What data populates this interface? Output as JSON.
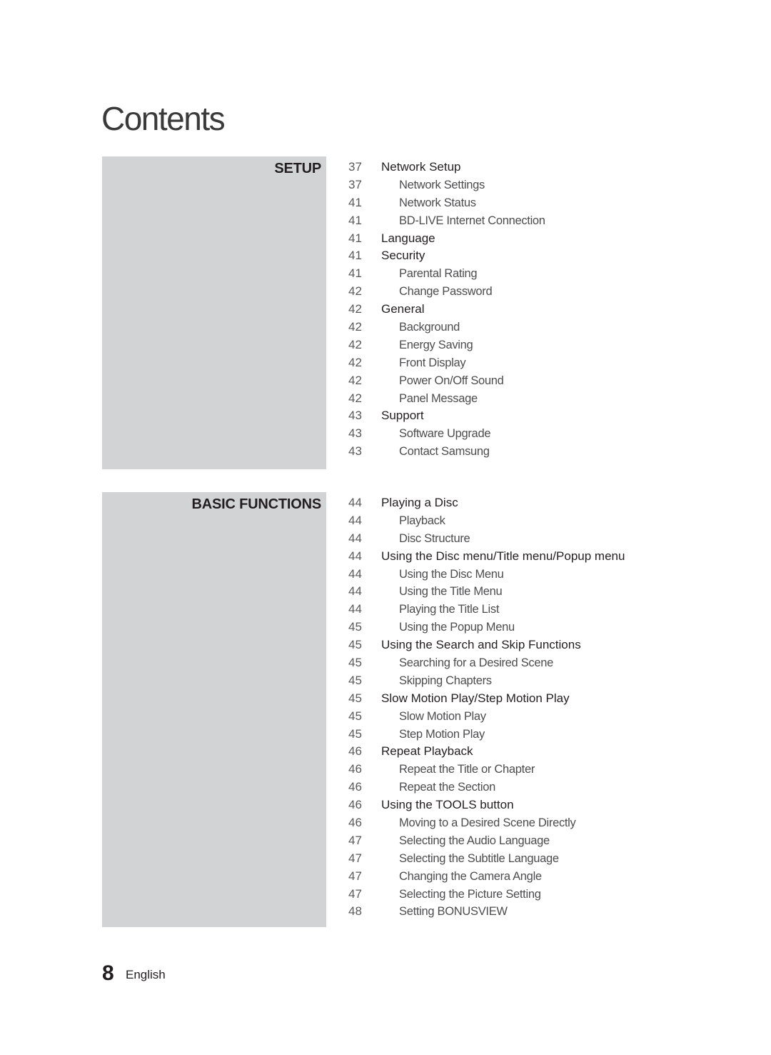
{
  "page": {
    "title": "Contents",
    "footer": {
      "page_number": "8",
      "language": "English"
    }
  },
  "sections": [
    {
      "label": "SETUP",
      "entries": [
        {
          "page": "37",
          "title": "Network Setup",
          "level": "main"
        },
        {
          "page": "37",
          "title": "Network Settings",
          "level": "sub"
        },
        {
          "page": "41",
          "title": "Network Status",
          "level": "sub"
        },
        {
          "page": "41",
          "title": "BD-LIVE Internet Connection",
          "level": "sub"
        },
        {
          "page": "41",
          "title": "Language",
          "level": "main"
        },
        {
          "page": "41",
          "title": "Security",
          "level": "main"
        },
        {
          "page": "41",
          "title": "Parental Rating",
          "level": "sub"
        },
        {
          "page": "42",
          "title": "Change Password",
          "level": "sub"
        },
        {
          "page": "42",
          "title": "General",
          "level": "main"
        },
        {
          "page": "42",
          "title": "Background",
          "level": "sub"
        },
        {
          "page": "42",
          "title": "Energy Saving",
          "level": "sub"
        },
        {
          "page": "42",
          "title": "Front Display",
          "level": "sub"
        },
        {
          "page": "42",
          "title": "Power On/Off Sound",
          "level": "sub"
        },
        {
          "page": "42",
          "title": "Panel Message",
          "level": "sub"
        },
        {
          "page": "43",
          "title": "Support",
          "level": "main"
        },
        {
          "page": "43",
          "title": "Software Upgrade",
          "level": "sub"
        },
        {
          "page": "43",
          "title": "Contact Samsung",
          "level": "sub"
        }
      ]
    },
    {
      "label": "BASIC FUNCTIONS",
      "entries": [
        {
          "page": "44",
          "title": "Playing a Disc",
          "level": "main"
        },
        {
          "page": "44",
          "title": "Playback",
          "level": "sub"
        },
        {
          "page": "44",
          "title": "Disc Structure",
          "level": "sub"
        },
        {
          "page": "44",
          "title": "Using the Disc menu/Title menu/Popup menu",
          "level": "main"
        },
        {
          "page": "44",
          "title": "Using the Disc Menu",
          "level": "sub"
        },
        {
          "page": "44",
          "title": "Using the Title Menu",
          "level": "sub"
        },
        {
          "page": "44",
          "title": "Playing the Title List",
          "level": "sub"
        },
        {
          "page": "45",
          "title": "Using the Popup Menu",
          "level": "sub"
        },
        {
          "page": "45",
          "title": "Using the Search and Skip Functions",
          "level": "main"
        },
        {
          "page": "45",
          "title": "Searching for a Desired Scene",
          "level": "sub"
        },
        {
          "page": "45",
          "title": "Skipping Chapters",
          "level": "sub"
        },
        {
          "page": "45",
          "title": "Slow Motion Play/Step Motion Play",
          "level": "main"
        },
        {
          "page": "45",
          "title": "Slow Motion Play",
          "level": "sub"
        },
        {
          "page": "45",
          "title": "Step Motion Play",
          "level": "sub"
        },
        {
          "page": "46",
          "title": "Repeat Playback",
          "level": "main"
        },
        {
          "page": "46",
          "title": "Repeat the Title or Chapter",
          "level": "sub"
        },
        {
          "page": "46",
          "title": "Repeat the Section",
          "level": "sub"
        },
        {
          "page": "46",
          "title": "Using the TOOLS button",
          "level": "main"
        },
        {
          "page": "46",
          "title": "Moving to a Desired Scene Directly",
          "level": "sub"
        },
        {
          "page": "47",
          "title": "Selecting the Audio Language",
          "level": "sub"
        },
        {
          "page": "47",
          "title": "Selecting the Subtitle Language",
          "level": "sub"
        },
        {
          "page": "47",
          "title": "Changing the Camera Angle",
          "level": "sub"
        },
        {
          "page": "47",
          "title": "Selecting the Picture Setting",
          "level": "sub"
        },
        {
          "page": "48",
          "title": "Setting BONUSVIEW",
          "level": "sub"
        }
      ]
    }
  ]
}
